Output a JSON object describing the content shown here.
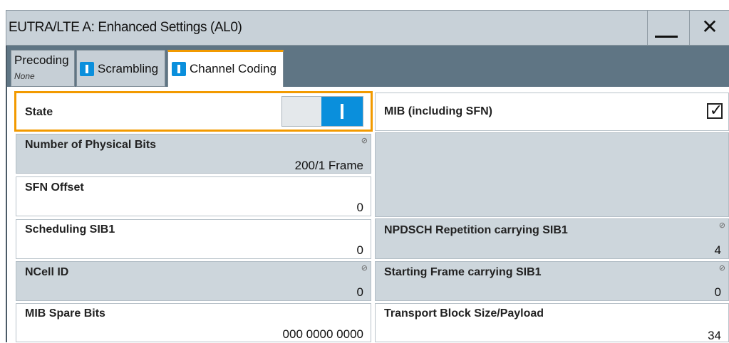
{
  "window": {
    "title": "EUTRA/LTE A: Enhanced Settings (AL0)",
    "minimize_glyph": "—",
    "close_glyph": "✕"
  },
  "tabs": [
    {
      "label": "Precoding",
      "sub": "None",
      "active": false
    },
    {
      "label": "Scrambling",
      "active": false
    },
    {
      "label": "Channel Coding",
      "active": true
    }
  ],
  "fields": {
    "state": {
      "label": "State",
      "value": "On"
    },
    "mib": {
      "label": "MIB (including SFN)",
      "checked": true,
      "check_glyph": "✓"
    },
    "num_physical_bits": {
      "label": "Number of Physical Bits",
      "value": "200/1 Frame"
    },
    "sfn_offset": {
      "label": "SFN Offset",
      "value": "0"
    },
    "scheduling_sib1": {
      "label": "Scheduling SIB1",
      "value": "0"
    },
    "npdsch_repetition": {
      "label": "NPDSCH Repetition carrying SIB1",
      "value": "4"
    },
    "ncell_id": {
      "label": "NCell ID",
      "value": "0"
    },
    "starting_frame": {
      "label": "Starting Frame carrying SIB1",
      "value": "0"
    },
    "mib_spare_bits": {
      "label": "MIB Spare Bits",
      "value": "000 0000 0000"
    },
    "transport_block_size": {
      "label": "Transport Block Size/Payload",
      "value": "34"
    }
  },
  "icons": {
    "readonly": "lock-icon",
    "tab_indicator": "active-indicator-icon"
  },
  "colors": {
    "accent_orange": "#f29a00",
    "toggle_blue": "#0a8fdc",
    "tab_strip": "#5f7584",
    "readonly_bg": "#cdd6dc"
  }
}
